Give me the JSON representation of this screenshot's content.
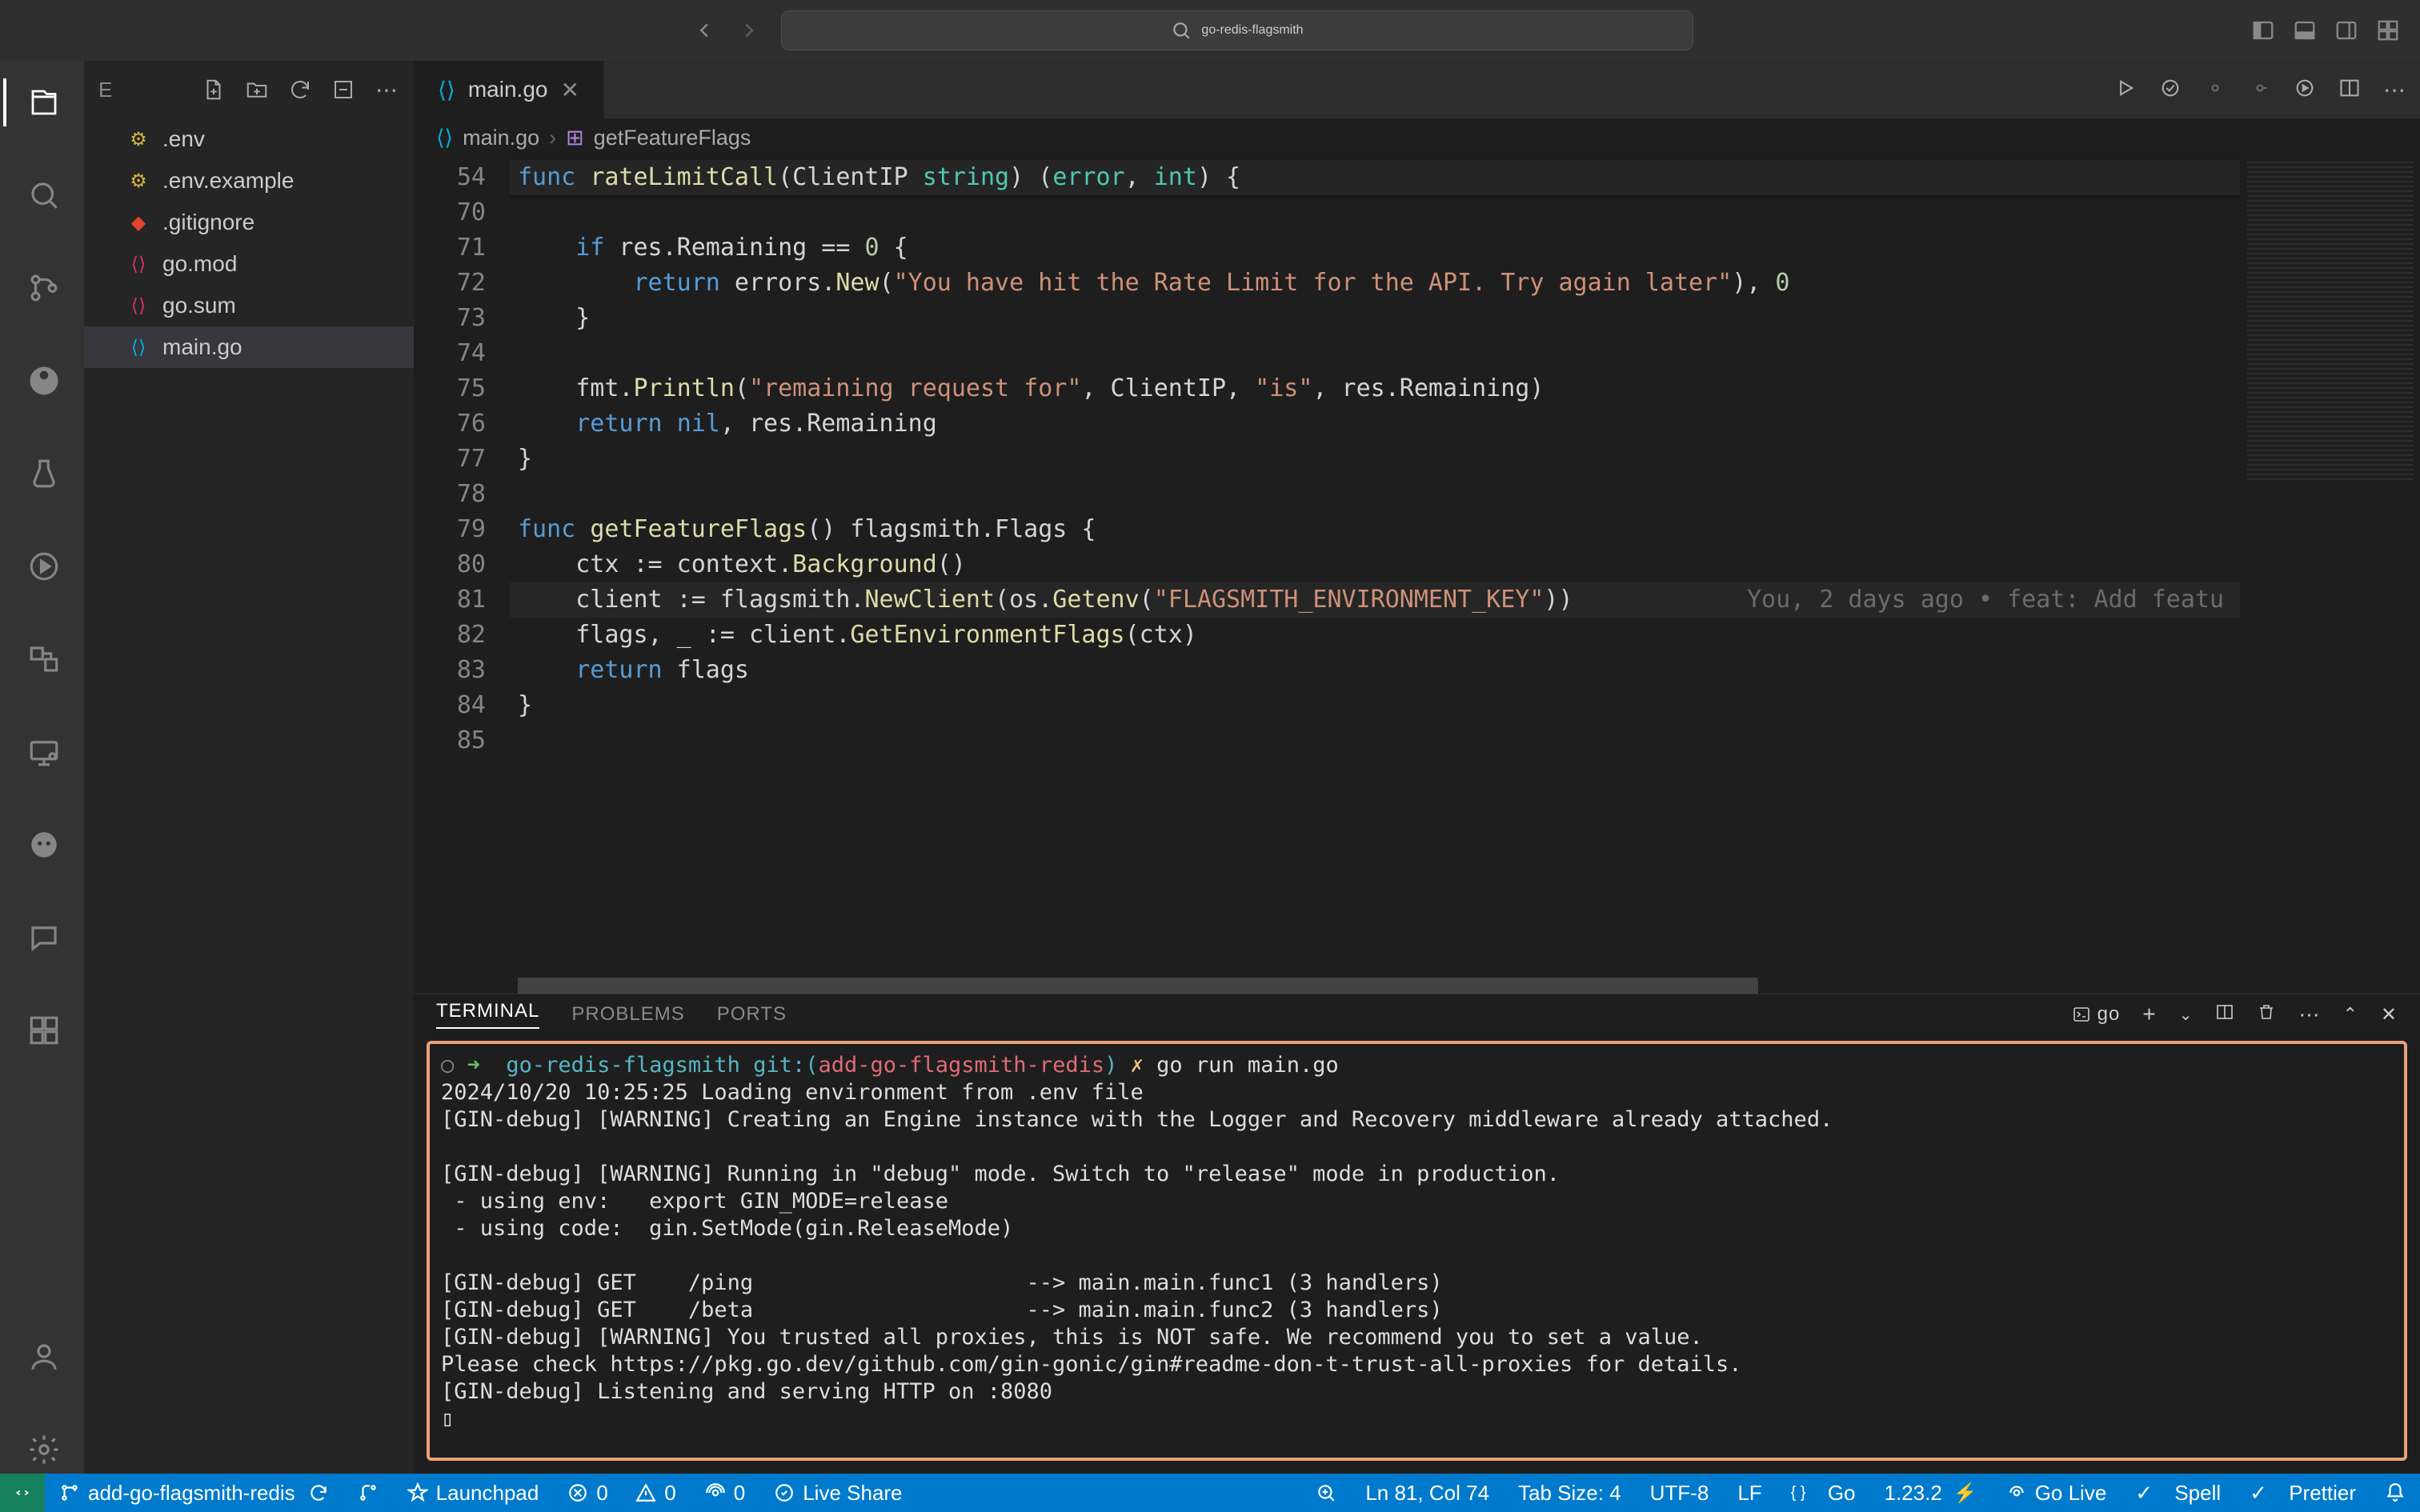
{
  "title": {
    "search_text": "go-redis-flagsmith"
  },
  "sidebar": {
    "header_label": "E",
    "files": [
      {
        "icon": "env-icon",
        "name": ".env"
      },
      {
        "icon": "env-icon",
        "name": ".env.example"
      },
      {
        "icon": "git-icon",
        "name": ".gitignore"
      },
      {
        "icon": "go-icon",
        "name": "go.mod"
      },
      {
        "icon": "go-icon",
        "name": "go.sum"
      },
      {
        "icon": "go-icon",
        "name": "main.go"
      }
    ]
  },
  "tabs": {
    "active": {
      "icon": "go-icon",
      "label": "main.go"
    }
  },
  "breadcrumb": {
    "file": "main.go",
    "symbol": "getFeatureFlags"
  },
  "code": {
    "sticky_line_no": "54",
    "sticky_line": "func rateLimitCall(ClientIP string) (error, int) {",
    "lines": [
      {
        "no": "70",
        "txt": ""
      },
      {
        "no": "71",
        "txt": "    if res.Remaining == 0 {"
      },
      {
        "no": "72",
        "txt": "        return errors.New(\"You have hit the Rate Limit for the API. Try again later\"), 0"
      },
      {
        "no": "73",
        "txt": "    }"
      },
      {
        "no": "74",
        "txt": ""
      },
      {
        "no": "75",
        "txt": "    fmt.Println(\"remaining request for\", ClientIP, \"is\", res.Remaining)"
      },
      {
        "no": "76",
        "txt": "    return nil, res.Remaining"
      },
      {
        "no": "77",
        "txt": "}"
      },
      {
        "no": "78",
        "txt": ""
      },
      {
        "no": "79",
        "txt": "func getFeatureFlags() flagsmith.Flags {"
      },
      {
        "no": "80",
        "txt": "    ctx := context.Background()"
      },
      {
        "no": "81",
        "txt": "    client := flagsmith.NewClient(os.Getenv(\"FLAGSMITH_ENVIRONMENT_KEY\"))",
        "hl": true,
        "lens": "You, 2 days ago • feat: Add featu"
      },
      {
        "no": "82",
        "txt": "    flags, _ := client.GetEnvironmentFlags(ctx)"
      },
      {
        "no": "83",
        "txt": "    return flags"
      },
      {
        "no": "84",
        "txt": "}"
      },
      {
        "no": "85",
        "txt": ""
      }
    ]
  },
  "panel": {
    "tabs": [
      "TERMINAL",
      "PROBLEMS",
      "PORTS"
    ],
    "shell_label": "go",
    "terminal": {
      "prompt_dir": "go-redis-flagsmith",
      "prompt_git": "git:(add-go-flagsmith-redis)",
      "cmd": "go run main.go",
      "lines": [
        "2024/10/20 10:25:25 Loading environment from .env file",
        "[GIN-debug] [WARNING] Creating an Engine instance with the Logger and Recovery middleware already attached.",
        "",
        "[GIN-debug] [WARNING] Running in \"debug\" mode. Switch to \"release\" mode in production.",
        " - using env:   export GIN_MODE=release",
        " - using code:  gin.SetMode(gin.ReleaseMode)",
        "",
        "[GIN-debug] GET    /ping                     --> main.main.func1 (3 handlers)",
        "[GIN-debug] GET    /beta                     --> main.main.func2 (3 handlers)",
        "[GIN-debug] [WARNING] You trusted all proxies, this is NOT safe. We recommend you to set a value.",
        "Please check https://pkg.go.dev/github.com/gin-gonic/gin#readme-don-t-trust-all-proxies for details.",
        "[GIN-debug] Listening and serving HTTP on :8080",
        "▯"
      ]
    }
  },
  "status": {
    "branch": "add-go-flagsmith-redis",
    "launchpad": "Launchpad",
    "errors": "0",
    "warnings": "0",
    "ports": "0",
    "live_share": "Live Share",
    "cursor": "Ln 81, Col 74",
    "tab_size": "Tab Size: 4",
    "encoding": "UTF-8",
    "eol": "LF",
    "lang": "Go",
    "go_ver": "1.23.2",
    "go_live": "Go Live",
    "spell": "Spell",
    "prettier": "Prettier"
  }
}
